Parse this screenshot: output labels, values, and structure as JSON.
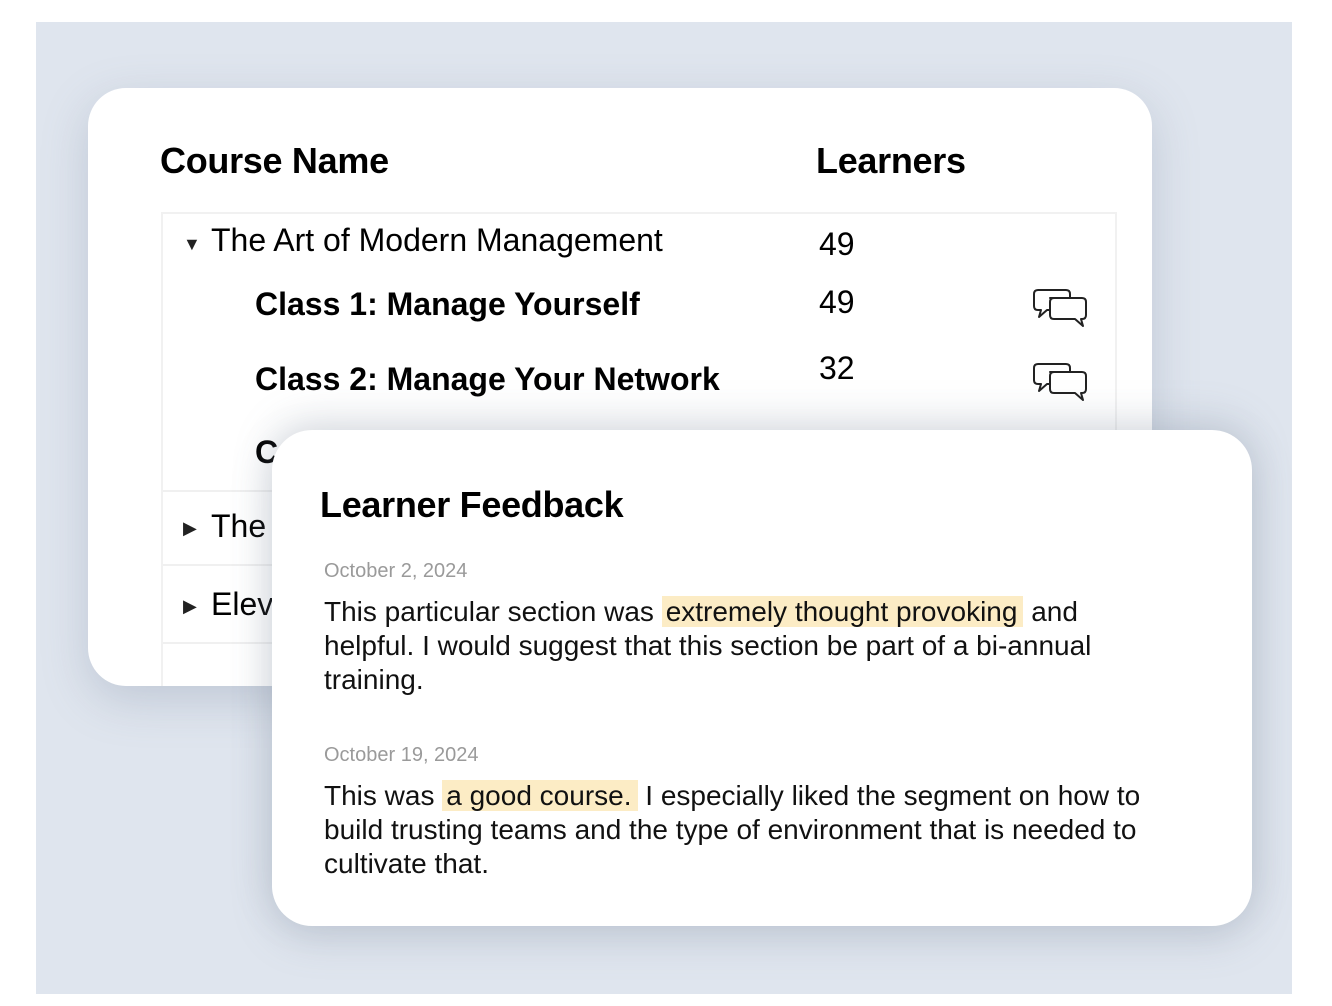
{
  "courses_table": {
    "columns": {
      "course_name": "Course Name",
      "learners": "Learners"
    },
    "rows": [
      {
        "type": "course",
        "expanded": true,
        "expander_icon": "caret-down-icon",
        "title": "The Art of Modern Management",
        "learners": "49",
        "children": [
          {
            "title": "Class 1: Manage Yourself",
            "learners": "49",
            "icon": "chat-bubbles-icon"
          },
          {
            "title": "Class 2: Manage Your  Network",
            "learners": "32",
            "icon": "chat-bubbles-icon"
          },
          {
            "title": "C",
            "learners": "",
            "icon": ""
          }
        ]
      },
      {
        "type": "course",
        "expanded": false,
        "expander_icon": "caret-right-icon",
        "title": "The"
      },
      {
        "type": "course",
        "expanded": false,
        "expander_icon": "caret-right-icon",
        "title": "Elev"
      }
    ]
  },
  "feedback": {
    "title": "Learner Feedback",
    "entries": [
      {
        "date": "October 2, 2024",
        "text_before": "This particular section was ",
        "highlight": "extremely thought provoking",
        "text_after": " and helpful. I would suggest that this section be part of a bi-annual training."
      },
      {
        "date": "October 19, 2024",
        "text_before": "This was ",
        "highlight": "a good course.",
        "text_after": " I especially liked the segment on how to build trusting teams and the type of environment that is needed to cultivate that."
      }
    ]
  },
  "colors": {
    "backdrop": "#dfe5ee",
    "highlight": "#fcecc5",
    "date_text": "#9a9a9a"
  }
}
